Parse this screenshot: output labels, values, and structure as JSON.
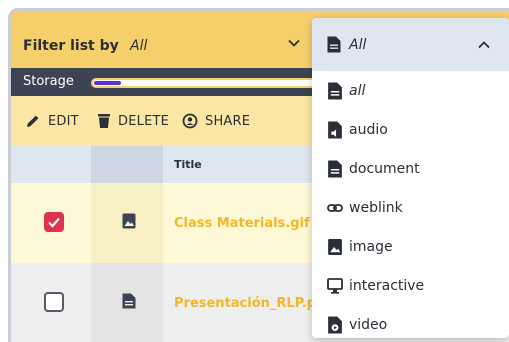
{
  "filter": {
    "label": "Filter list by",
    "value": "All"
  },
  "storage": {
    "label": "Storage",
    "used_fraction": 0.12
  },
  "toolbar": {
    "edit_label": "EDIT",
    "delete_label": "DELETE",
    "share_label": "SHARE"
  },
  "table": {
    "title_header": "Title",
    "rows": [
      {
        "name": "Class Materials.gif",
        "checked": true,
        "icon": "image-file-icon"
      },
      {
        "name": "Presentación_RLP.pd",
        "checked": false,
        "icon": "document-file-icon"
      }
    ]
  },
  "dropdown": {
    "selected": "All",
    "options": [
      {
        "label": "all",
        "icon": "document-icon"
      },
      {
        "label": "audio",
        "icon": "audio-file-icon"
      },
      {
        "label": "document",
        "icon": "document-icon"
      },
      {
        "label": "weblink",
        "icon": "link-icon"
      },
      {
        "label": "image",
        "icon": "image-icon"
      },
      {
        "label": "interactive",
        "icon": "monitor-icon"
      },
      {
        "label": "video",
        "icon": "video-file-icon"
      }
    ]
  },
  "colors": {
    "accent_yellow": "#f5cf6a",
    "storage_fill": "#5533d6",
    "checkbox_checked": "#e0334f",
    "file_name": "#f1b72d"
  }
}
